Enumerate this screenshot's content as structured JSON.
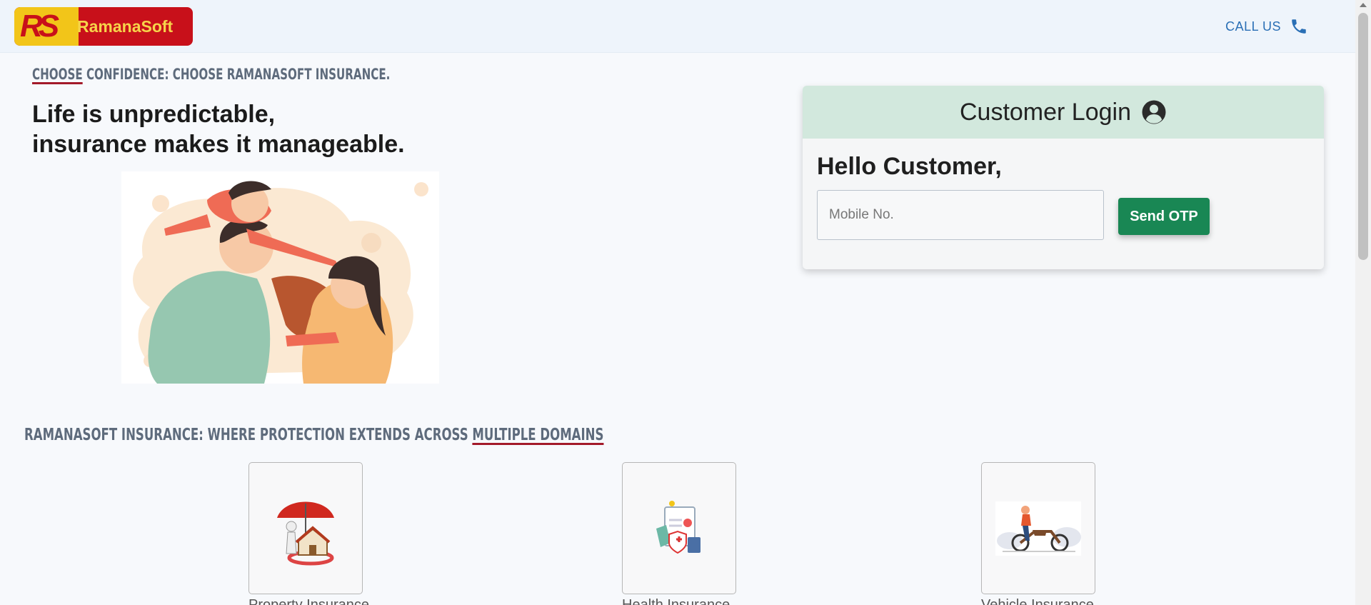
{
  "brand": {
    "name": "RamanaSoft",
    "mark": "RS"
  },
  "header": {
    "call_label": "CALL US"
  },
  "hero": {
    "tagline_underlined": "CHOOSE",
    "tagline_rest": " CONFIDENCE: CHOOSE RAMANASOFT INSURANCE.",
    "headline_line1": "Life is unpredictable,",
    "headline_line2": "insurance makes it manageable."
  },
  "login": {
    "title": "Customer Login",
    "greeting": "Hello Customer,",
    "mobile_placeholder": "Mobile No.",
    "mobile_value": "",
    "send_otp_label": "Send OTP"
  },
  "domains": {
    "title_prefix": "RAMANASOFT INSURANCE: WHERE PROTECTION EXTENDS ACROSS ",
    "title_underlined": "MULTIPLE DOMAINS",
    "items": [
      {
        "label": "Property Insurance",
        "icon": "property-insurance-icon"
      },
      {
        "label": "Health Insurance",
        "icon": "health-insurance-icon"
      },
      {
        "label": "Vehicle Insurance",
        "icon": "vehicle-insurance-icon"
      }
    ]
  },
  "colors": {
    "nav_bg": "#eef4fb",
    "logo_red": "#c8101a",
    "logo_yellow": "#f2c519",
    "call_blue": "#2a6fb5",
    "login_header_bg": "#d2e8dd",
    "otp_green": "#198754",
    "underline_red": "#a31a2a"
  }
}
